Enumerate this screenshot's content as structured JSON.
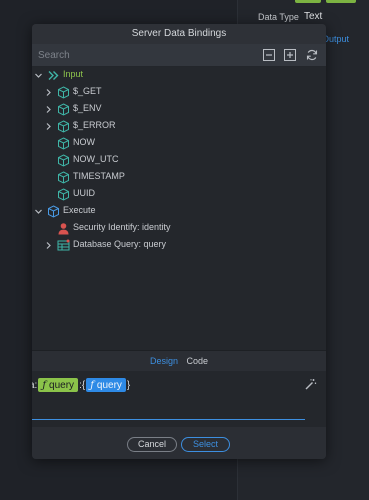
{
  "background": {
    "data_type_label": "Data Type",
    "data_type_value": "Text",
    "output_label": "Output"
  },
  "dialog": {
    "title": "Server Data Bindings",
    "search_placeholder": "Search",
    "toolbar_icons": [
      "collapse-all-icon",
      "expand-all-icon",
      "refresh-icon"
    ],
    "tree": {
      "input": {
        "label": "Input",
        "children": [
          {
            "label": "$_GET",
            "expandable": true
          },
          {
            "label": "$_ENV",
            "expandable": true
          },
          {
            "label": "$_ERROR",
            "expandable": true
          },
          {
            "label": "NOW",
            "expandable": false
          },
          {
            "label": "NOW_UTC",
            "expandable": false
          },
          {
            "label": "TIMESTAMP",
            "expandable": false
          },
          {
            "label": "UUID",
            "expandable": false
          }
        ]
      },
      "execute": {
        "label": "Execute",
        "children": [
          {
            "label": "Security Identify: identity",
            "expandable": false
          },
          {
            "label": "Database Query: query",
            "expandable": true
          }
        ]
      }
    },
    "tabs": {
      "design": "Design",
      "code": "Code"
    },
    "expression": {
      "prefix": "a:",
      "separator": ":",
      "suffix": "}",
      "chip_green": {
        "glyph": "ƒ",
        "label": "query"
      },
      "chip_blue": {
        "glyph": "ƒ",
        "label": "query"
      }
    },
    "buttons": {
      "cancel": "Cancel",
      "select": "Select"
    }
  },
  "colors": {
    "accent": "#3d8fe0",
    "selected_text": "#8fc64d",
    "chip_green": "#8bc34a",
    "chip_blue": "#2e8ae6"
  }
}
